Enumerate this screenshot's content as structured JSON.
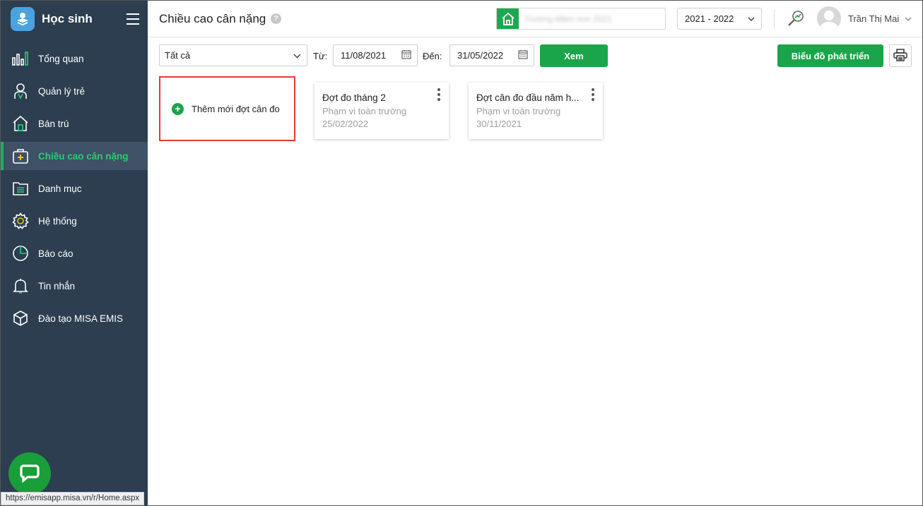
{
  "sidebar": {
    "app_title": "Học sinh",
    "items": [
      {
        "label": "Tổng quan",
        "icon": "bar-chart-icon"
      },
      {
        "label": "Quản lý trẻ",
        "icon": "student-icon"
      },
      {
        "label": "Bán trú",
        "icon": "house-icon"
      },
      {
        "label": "Chiều cao cân nặng",
        "icon": "medical-kit-icon",
        "active": true
      },
      {
        "label": "Danh mục",
        "icon": "folder-list-icon"
      },
      {
        "label": "Hệ thống",
        "icon": "gear-icon"
      },
      {
        "label": "Báo cáo",
        "icon": "pie-chart-icon"
      },
      {
        "label": "Tin nhắn",
        "icon": "bell-icon"
      },
      {
        "label": "Đào tạo MISA EMIS",
        "icon": "cube-icon"
      }
    ]
  },
  "header": {
    "title": "Chiều cao cân nặng",
    "help": "?",
    "school_name": "Trường Mầm non 2021",
    "school_year": "2021 - 2022",
    "user_name": "Trần Thị Mai"
  },
  "toolbar": {
    "scope_value": "Tất cả",
    "from_label": "Từ:",
    "from_date": "11/08/2021",
    "to_label": "Đến:",
    "to_date": "31/05/2022",
    "view_button": "Xem",
    "chart_button": "Biểu đồ phát triển"
  },
  "add_card": {
    "label": "Thêm mới đợt cân đo"
  },
  "cards": [
    {
      "title": "Đợt đo tháng 2",
      "scope": "Phạm vi toàn trường",
      "date": "25/02/2022"
    },
    {
      "title": "Đợt cân đo đầu năm h...",
      "scope": "Phạm vi toàn trường",
      "date": "30/11/2021"
    }
  ],
  "status_bar": {
    "url": "https://emisapp.misa.vn/r/Home.aspx"
  },
  "colors": {
    "sidebar_bg": "#2c3e50",
    "accent_green": "#1aa54a",
    "highlight_red": "#e53935"
  }
}
